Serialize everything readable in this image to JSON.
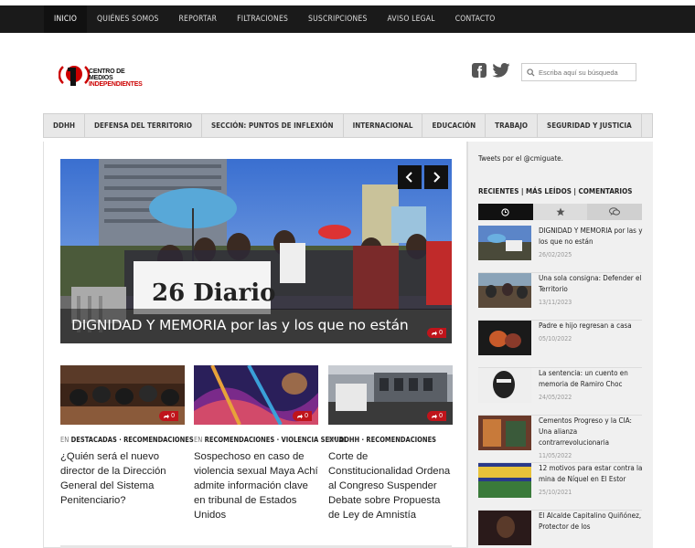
{
  "topnav": {
    "items": [
      "INICIO",
      "QUIÉNES SOMOS",
      "REPORTAR",
      "FILTRACIONES",
      "SUSCRIPCIONES",
      "AVISO LEGAL",
      "CONTACTO"
    ]
  },
  "logo": {
    "line1": "CENTRO DE MEDIOS",
    "line2": "INDEPENDIENTES"
  },
  "search": {
    "placeholder": "Escriba aquí su búsqueda"
  },
  "catnav": {
    "items": [
      "DDHH",
      "DEFENSA DEL TERRITORIO",
      "SECCIÓN: PUNTOS DE INFLEXIÓN",
      "INTERNACIONAL",
      "EDUCACIÓN",
      "TRABAJO",
      "SEGURIDAD Y JUSTICIA"
    ]
  },
  "hero": {
    "title": "DIGNIDAD Y MEMORIA por las y los que no están",
    "comments": "0",
    "banner_text": "26 Diario"
  },
  "cards": [
    {
      "en": "EN",
      "cats": "DESTACADAS · RECOMENDACIONES",
      "title": "¿Quién será el nuevo director de la Dirección General del Sistema Penitenciario?",
      "comments": "0"
    },
    {
      "en": "EN",
      "cats": "RECOMENDACIONES · VIOLENCIA SEXUAL",
      "title": "Sospechoso en caso de violencia sexual Maya Achí admite información clave en tribunal de Estados Unidos",
      "comments": "0"
    },
    {
      "en": "EN",
      "cats": "DDHH · RECOMENDACIONES",
      "title": "Corte de Constitucionalidad Ordena al Congreso Suspender Debate sobre Propuesta de Ley de Amnistía",
      "comments": "0"
    }
  ],
  "sidebar": {
    "tweets": "Tweets por el @cmiguate.",
    "tabs_title": "RECIENTES | MÁS LEÍDOS | COMENTARIOS",
    "posts": [
      {
        "title": "DIGNIDAD Y MEMORIA por las y los que no están",
        "date": "26/02/2025"
      },
      {
        "title": "Una sola consigna: Defender el Territorio",
        "date": "13/11/2023"
      },
      {
        "title": "Padre e hijo regresan a casa",
        "date": "05/10/2022"
      },
      {
        "title": "La sentencia: un cuento en memoria de Ramiro Choc",
        "date": "24/05/2022"
      },
      {
        "title": "Cementos Progreso y la CIA: Una alianza contrarrevolucionaria",
        "date": "11/05/2022"
      },
      {
        "title": "12 motivos para estar contra la mina de Níquel en El Estor",
        "date": "25/10/2021"
      },
      {
        "title": "El Alcalde Capitalino Quiñónez, Protector de los",
        "date": ""
      }
    ]
  },
  "colors": {
    "accent": "#c0141b",
    "nav_bg": "#1a1a1a"
  }
}
